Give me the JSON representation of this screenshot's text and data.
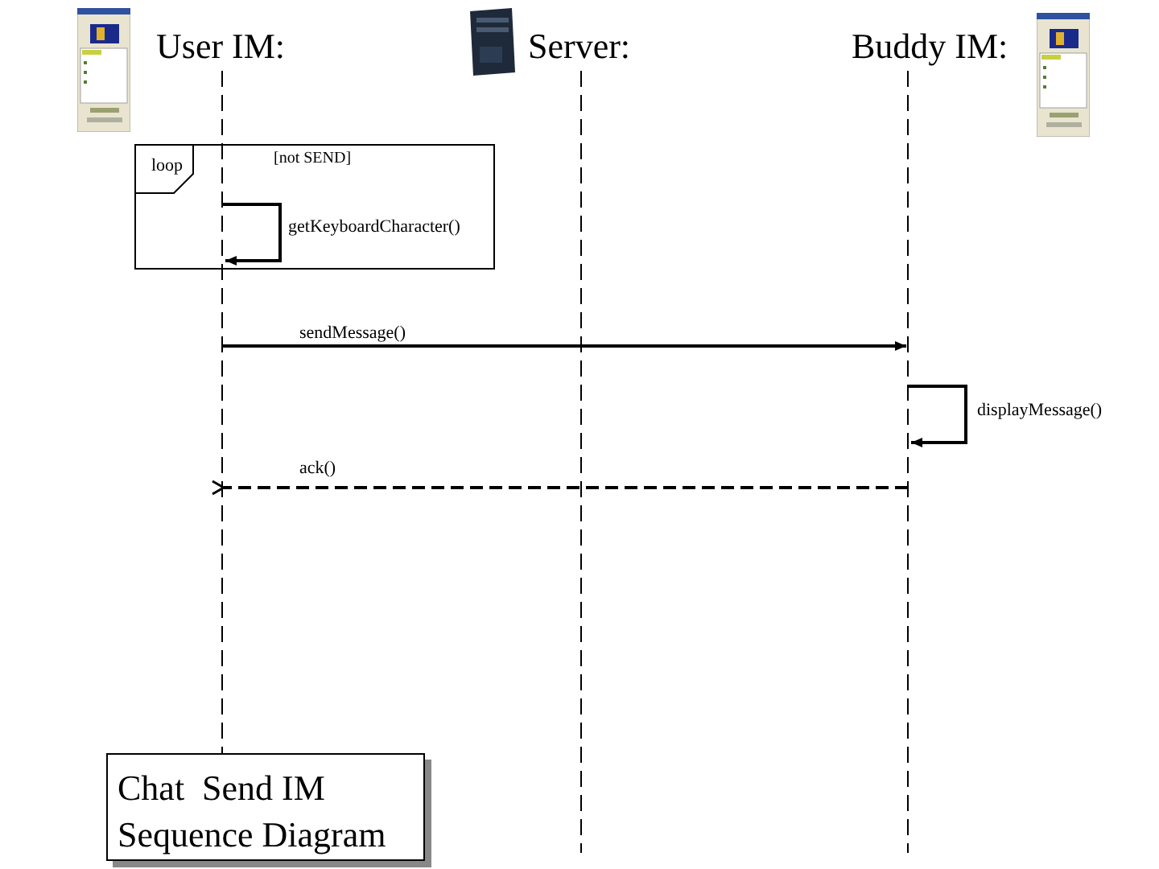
{
  "participants": [
    {
      "name": "User IM:",
      "kind": "client"
    },
    {
      "name": "Server:",
      "kind": "server"
    },
    {
      "name": "Buddy IM:",
      "kind": "client"
    }
  ],
  "loop": {
    "label": "loop",
    "guard": "[not SEND]"
  },
  "messages": [
    {
      "label": "getKeyboardCharacter()",
      "kind": "self"
    },
    {
      "label": "sendMessage()",
      "kind": "call"
    },
    {
      "label": "displayMessage()",
      "kind": "self"
    },
    {
      "label": "ack()",
      "kind": "return"
    }
  ],
  "note": {
    "lines": [
      "Chat  Send IM",
      "Sequence Diagram"
    ]
  }
}
